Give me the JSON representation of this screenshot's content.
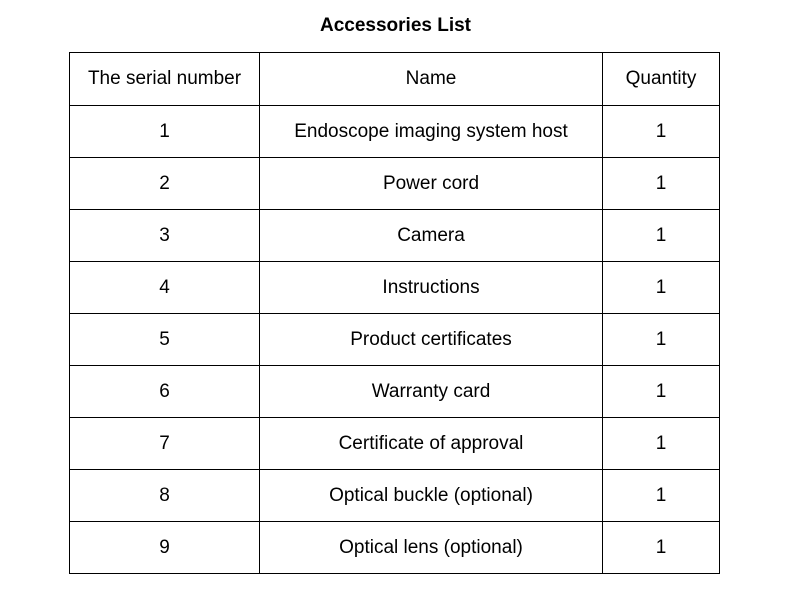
{
  "title": "Accessories List",
  "table": {
    "headers": [
      "The serial number",
      "Name",
      "Quantity"
    ],
    "rows": [
      [
        "1",
        "Endoscope imaging system host",
        "1"
      ],
      [
        "2",
        "Power cord",
        "1"
      ],
      [
        "3",
        "Camera",
        "1"
      ],
      [
        "4",
        "Instructions",
        "1"
      ],
      [
        "5",
        "Product certificates",
        "1"
      ],
      [
        "6",
        "Warranty card",
        "1"
      ],
      [
        "7",
        "Certificate of approval",
        "1"
      ],
      [
        "8",
        "Optical buckle (optional)",
        "1"
      ],
      [
        "9",
        "Optical lens (optional)",
        "1"
      ]
    ]
  }
}
